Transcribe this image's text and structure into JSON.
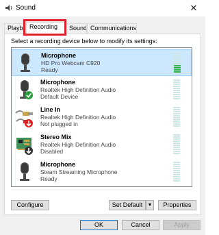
{
  "window": {
    "title": "Sound",
    "close_glyph": "✕"
  },
  "tabs": [
    {
      "label": "Playback"
    },
    {
      "label": "Recording"
    },
    {
      "label": "Sounds"
    },
    {
      "label": "Communications"
    }
  ],
  "active_tab": "Recording",
  "instruction": "Select a recording device below to modify its settings:",
  "devices": [
    {
      "name": "Microphone",
      "driver": "HD Pro Webcam C920",
      "status": "Ready",
      "icon": "microphone-icon",
      "badge": null,
      "selected": true,
      "meter_level": 0.4
    },
    {
      "name": "Microphone",
      "driver": "Realtek High Definition Audio",
      "status": "Default Device",
      "icon": "microphone-icon",
      "badge": "check-badge-icon",
      "selected": false,
      "meter_level": 0
    },
    {
      "name": "Line In",
      "driver": "Realtek High Definition Audio",
      "status": "Not plugged in",
      "icon": "line-in-jack-icon",
      "badge": "red-down-arrow-badge-icon",
      "selected": false,
      "meter_level": 0
    },
    {
      "name": "Stereo Mix",
      "driver": "Realtek High Definition Audio",
      "status": "Disabled",
      "icon": "circuit-board-icon",
      "badge": "down-arrow-badge-icon",
      "selected": false,
      "meter_level": 0
    },
    {
      "name": "Microphone",
      "driver": "Steam Streaming Microphone",
      "status": "Ready",
      "icon": "microphone-icon",
      "badge": null,
      "selected": false,
      "meter_level": 0
    }
  ],
  "buttons": {
    "configure": "Configure",
    "set_default": "Set Default",
    "set_default_arrow": "▼",
    "properties": "Properties",
    "ok": "OK",
    "cancel": "Cancel",
    "apply": "Apply"
  },
  "colors": {
    "highlight_box": "#e0202a",
    "selected_row": "#cce8ff",
    "meter_active": "#32b14a",
    "meter_idle": "#cfe6e6",
    "check_badge": "#2a9d3e",
    "red_badge": "#e02020"
  }
}
